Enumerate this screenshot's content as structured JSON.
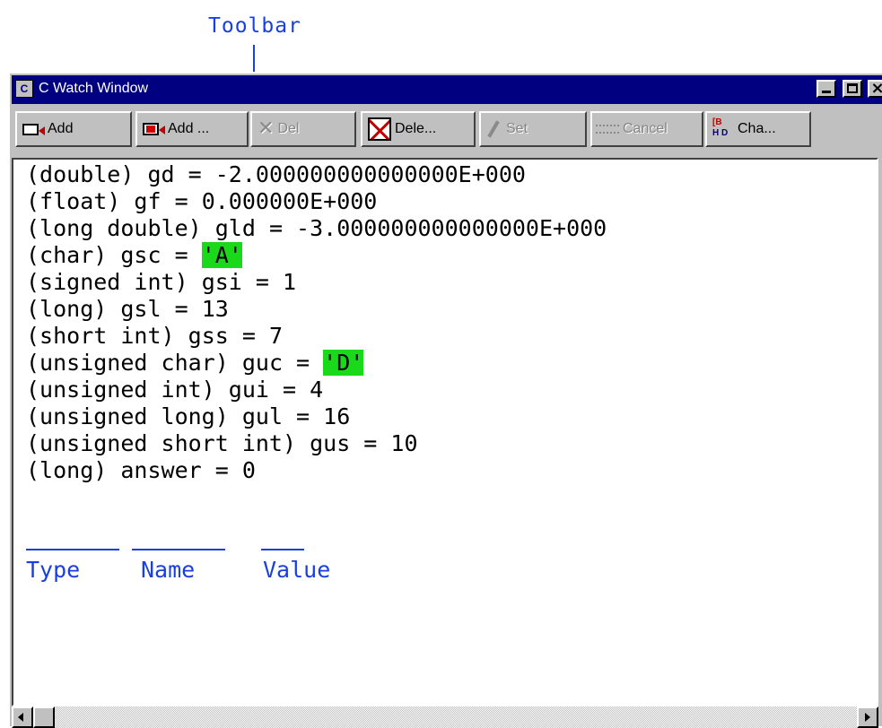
{
  "annotation": {
    "label": "Toolbar"
  },
  "window": {
    "title": "C Watch Window",
    "icon_letter": "C"
  },
  "toolbar": {
    "add": "Add",
    "add_special": "Add ...",
    "del": "Del",
    "delete_all": "Dele...",
    "set": "Set",
    "cancel": "Cancel",
    "charset": "Cha..."
  },
  "watch": {
    "items": [
      {
        "type": "(double)",
        "name": "gd",
        "value": "-2.000000000000000E+000"
      },
      {
        "type": "(float)",
        "name": "gf",
        "value": "0.000000E+000"
      },
      {
        "type": "(long double)",
        "name": "gld",
        "value": "-3.000000000000000E+000"
      },
      {
        "type": "(char)",
        "name": "gsc",
        "value": "'A'"
      },
      {
        "type": "(signed int)",
        "name": "gsi",
        "value": "1"
      },
      {
        "type": "(long)",
        "name": "gsl",
        "value": "13"
      },
      {
        "type": "(short int)",
        "name": "gss",
        "value": "7"
      },
      {
        "type": "(unsigned char)",
        "name": "guc",
        "value": "'D'"
      },
      {
        "type": "(unsigned int)",
        "name": "gui",
        "value": "4"
      },
      {
        "type": "(unsigned long)",
        "name": "gul",
        "value": "16"
      },
      {
        "type": "(unsigned short int)",
        "name": "gus",
        "value": "10"
      },
      {
        "type": "(long)",
        "name": "answer",
        "value": "0"
      }
    ],
    "highlight_color": "#1ad81a"
  },
  "legend": {
    "type": "Type",
    "name": "Name",
    "value": "Value",
    "color": "#1a3fe0"
  }
}
